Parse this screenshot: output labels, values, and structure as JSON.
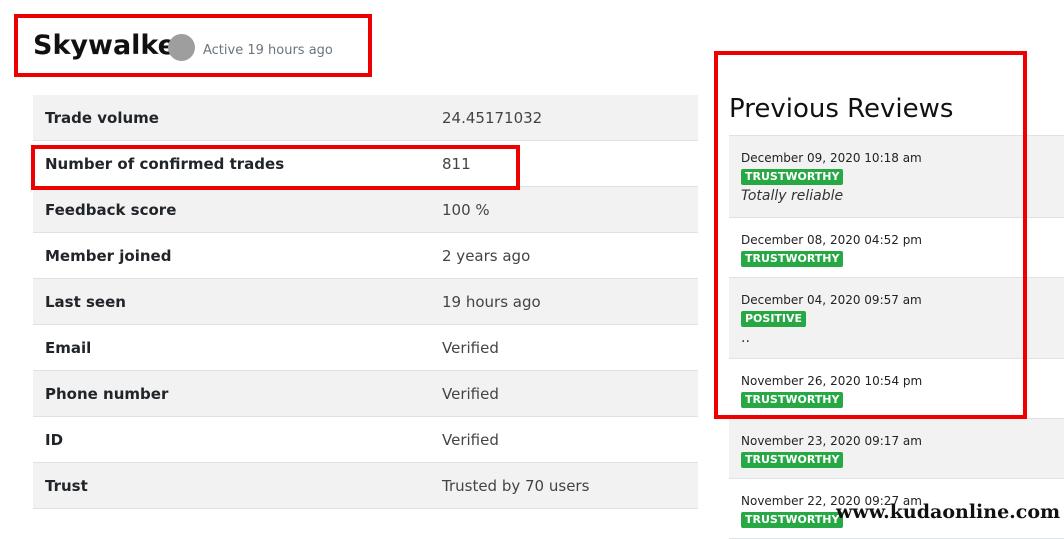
{
  "profile": {
    "username": "Skywalker",
    "active_status": "Active 19 hours ago",
    "status_dot_color": "#9e9e9e"
  },
  "stats": [
    {
      "label": "Trade volume",
      "value": "24.45171032"
    },
    {
      "label": "Number of confirmed trades",
      "value": "811"
    },
    {
      "label": "Feedback score",
      "value": "100 %"
    },
    {
      "label": "Member joined",
      "value": "2 years ago"
    },
    {
      "label": "Last seen",
      "value": "19 hours ago"
    },
    {
      "label": "Email",
      "value": "Verified"
    },
    {
      "label": "Phone number",
      "value": "Verified"
    },
    {
      "label": "ID",
      "value": "Verified"
    },
    {
      "label": "Trust",
      "value": "Trusted by 70 users"
    }
  ],
  "reviews": {
    "title": "Previous Reviews",
    "items": [
      {
        "date": "December 09, 2020 10:18 am",
        "badge": "TRUSTWORTHY",
        "comment": "Totally reliable"
      },
      {
        "date": "December 08, 2020 04:52 pm",
        "badge": "TRUSTWORTHY",
        "comment": ""
      },
      {
        "date": "December 04, 2020 09:57 am",
        "badge": "POSITIVE",
        "comment": ".."
      },
      {
        "date": "November 26, 2020 10:54 pm",
        "badge": "TRUSTWORTHY",
        "comment": ""
      },
      {
        "date": "November 23, 2020 09:17 am",
        "badge": "TRUSTWORTHY",
        "comment": ""
      },
      {
        "date": "November 22, 2020 09:27 am",
        "badge": "TRUSTWORTHY",
        "comment": ""
      }
    ]
  },
  "colors": {
    "badge": "#28a745",
    "highlight": "#ee0000"
  },
  "watermark": "www.kudaonline.com"
}
